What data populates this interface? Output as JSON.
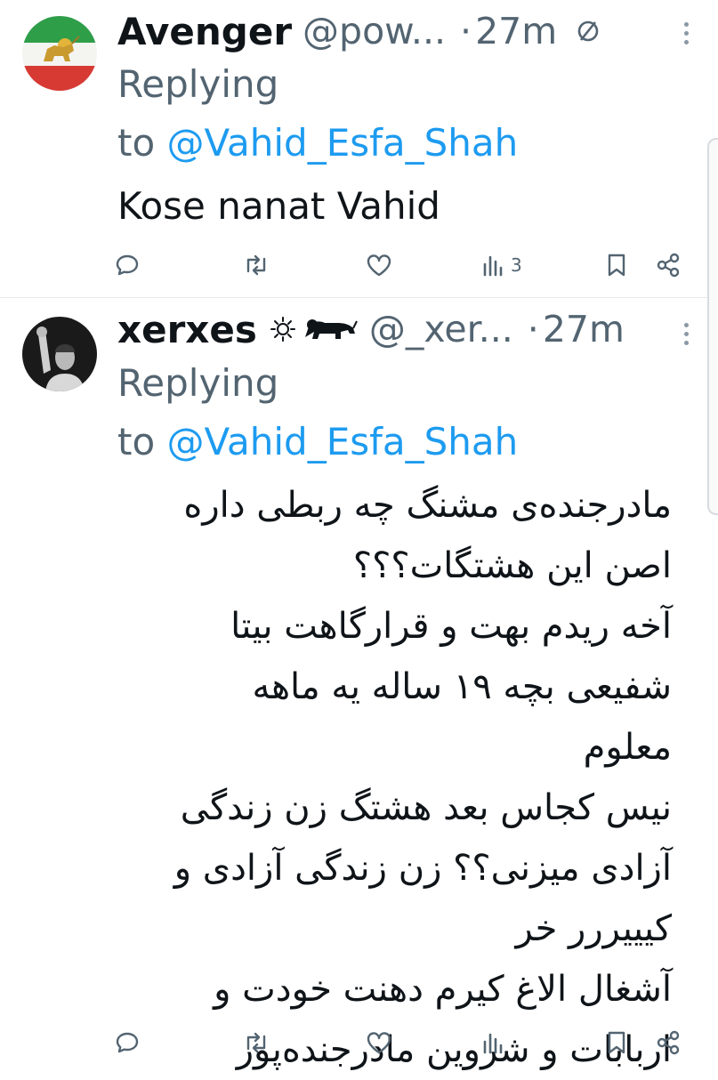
{
  "tweets": [
    {
      "name": "Avenger",
      "handle": "@pow...",
      "separator": "·",
      "time": "27m",
      "reply_prefix": "Replying",
      "reply_to_word": "to",
      "reply_to": "@Vahid_Esfa_Shah",
      "text": "Kose nanat Vahid",
      "views": "3",
      "header_icon": "muted-circle-slash-icon",
      "avatar": "iran-lion-sun-flag-avatar"
    },
    {
      "name": "xerxes",
      "handle": "@_xer...",
      "separator": "·",
      "time": "27m",
      "reply_prefix": "Replying",
      "reply_to_word": "to",
      "reply_to": "@Vahid_Esfa_Shah",
      "badges": [
        "sun-icon",
        "lion-icon"
      ],
      "avatar": "man-raising-fist-photo-avatar",
      "text_lines": [
        "مادرجنده‌ی مشنگ چه ربطی داره",
        "اصن این هشتگات؟؟؟",
        "آخه ریدم بهت و قرارگاهت بیتا",
        "شفیعی بچه ۱۹ ساله یه ماهه معلوم",
        "نیس کجاس بعد هشتگ زن زندگی",
        "آزادی میزنی؟؟ زن زندگی آزادی و",
        "کیییررر خر",
        "آشغال الاغ کیرم دهنت خودت و",
        "اربابات و شروین مادرجنده‌پور"
      ],
      "views": ""
    }
  ],
  "action_icons": [
    "reply-icon",
    "retweet-icon",
    "like-icon",
    "views-icon",
    "bookmark-icon",
    "share-icon"
  ],
  "colors": {
    "text": "#0f1419",
    "secondary": "#536471",
    "accent": "#1d9bf0",
    "divider": "#e6e9ec"
  }
}
